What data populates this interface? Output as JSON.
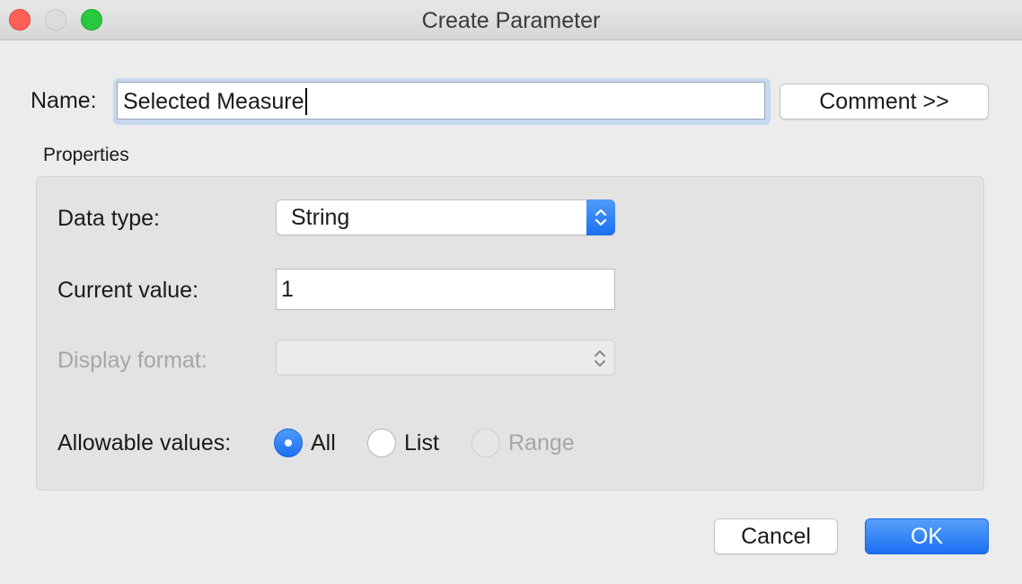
{
  "window": {
    "title": "Create Parameter"
  },
  "name": {
    "label": "Name:",
    "value": "Selected Measure",
    "comment_button": "Comment >>"
  },
  "properties": {
    "group_label": "Properties",
    "data_type": {
      "label": "Data type:",
      "selected": "String"
    },
    "current_value": {
      "label": "Current value:",
      "value": "1"
    },
    "display_format": {
      "label": "Display format:",
      "selected": "",
      "enabled": false
    },
    "allowable_values": {
      "label": "Allowable values:",
      "options": [
        {
          "label": "All",
          "checked": true,
          "enabled": true
        },
        {
          "label": "List",
          "checked": false,
          "enabled": true
        },
        {
          "label": "Range",
          "checked": false,
          "enabled": false
        }
      ]
    }
  },
  "buttons": {
    "cancel": "Cancel",
    "ok": "OK"
  },
  "colors": {
    "accent": "#1d6ff2",
    "close": "#fe5f57",
    "maximize": "#28c840",
    "window_bg": "#ececec"
  },
  "icons": {
    "select_stepper": "chevron-up-down-icon"
  }
}
